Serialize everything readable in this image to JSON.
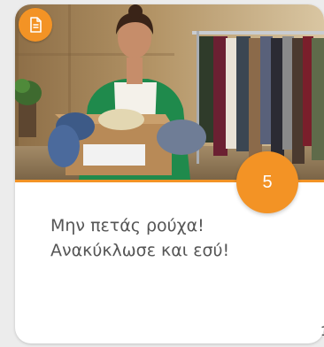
{
  "card": {
    "title_line_1": "Μην πετάς ρούχα!",
    "title_line_2": "Ανακύκλωσε και εσύ!",
    "number": "5",
    "type_icon": "document-icon",
    "image": "woman-holding-box-of-clothes-with-clothing-rack"
  },
  "edge_text": "1",
  "colors": {
    "accent": "#f39325",
    "title_text": "#555555",
    "card_background": "#ffffff",
    "page_background": "#ececec"
  }
}
